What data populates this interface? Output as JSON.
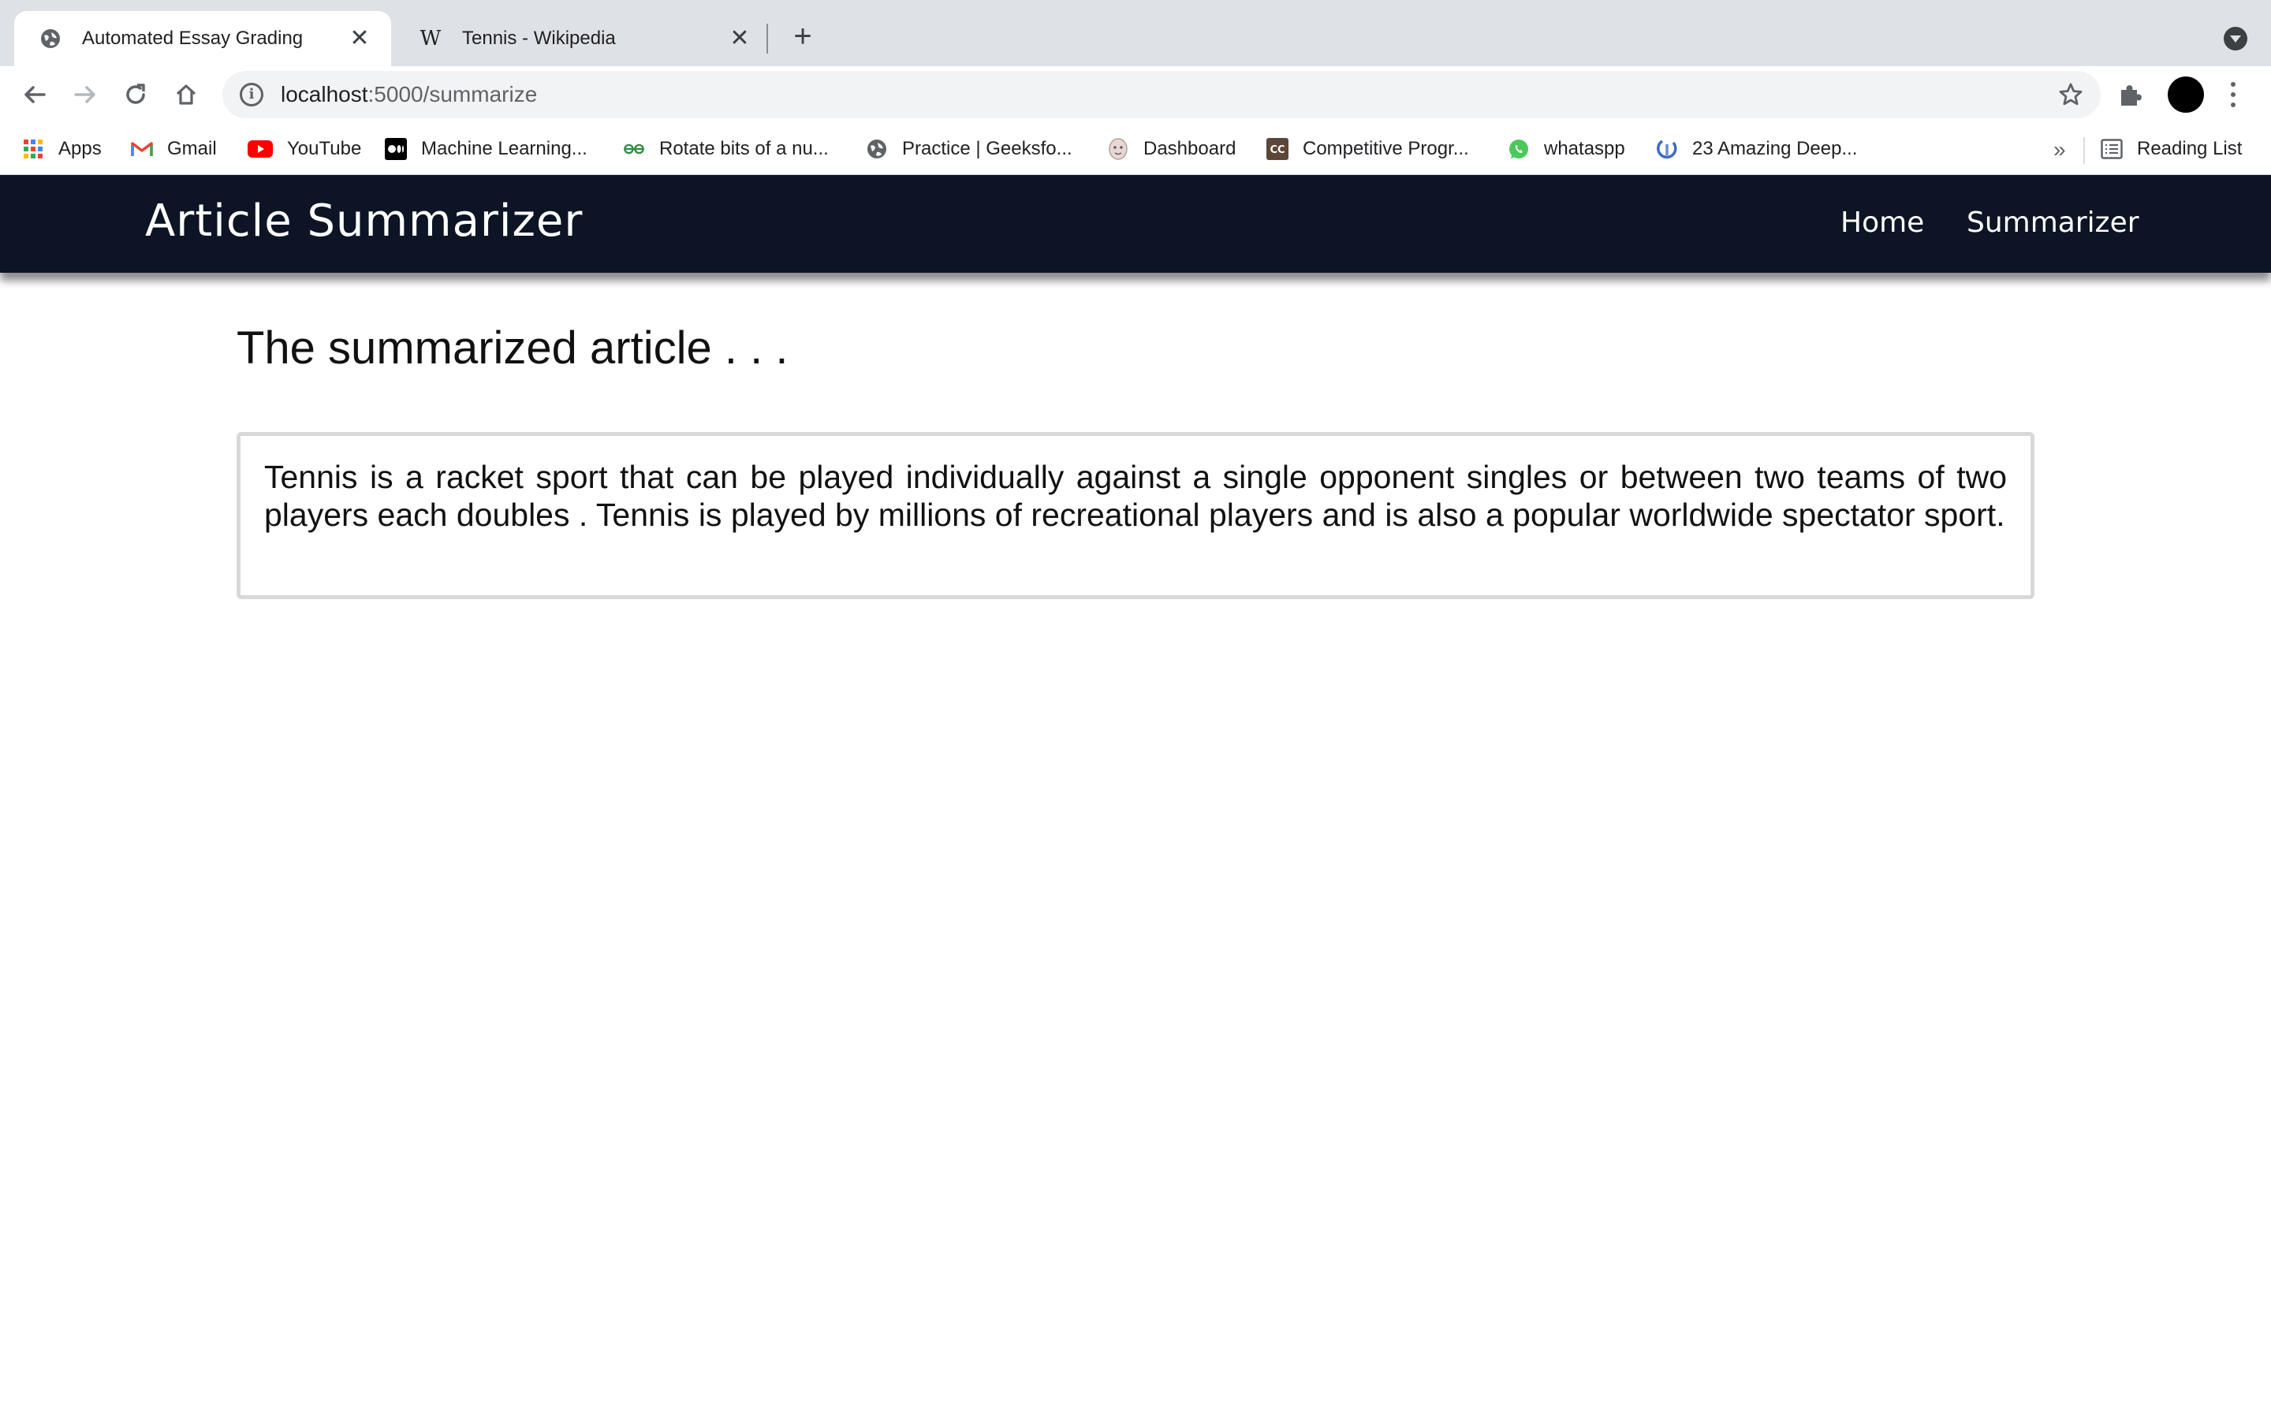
{
  "browser": {
    "tabs": [
      {
        "title": "Automated Essay Grading",
        "favicon": "globe-icon",
        "active": true
      },
      {
        "title": "Tennis - Wikipedia",
        "favicon": "wikipedia-icon",
        "active": false
      }
    ],
    "close_glyph": "✕",
    "new_tab_glyph": "+",
    "address": {
      "host": "localhost",
      "path": ":5000/summarize"
    },
    "bookmarks": [
      {
        "label": "Apps",
        "icon": "apps-grid-icon"
      },
      {
        "label": "Gmail",
        "icon": "gmail-icon"
      },
      {
        "label": "YouTube",
        "icon": "youtube-icon"
      },
      {
        "label": "Machine Learning...",
        "icon": "medium-icon"
      },
      {
        "label": "Rotate bits of a nu...",
        "icon": "geeksforgeeks-icon"
      },
      {
        "label": "Practice | Geeksfo...",
        "icon": "globe-icon"
      },
      {
        "label": "Dashboard",
        "icon": "dashboard-avatar-icon"
      },
      {
        "label": "Competitive Progr...",
        "icon": "codechef-icon"
      },
      {
        "label": "whataspp",
        "icon": "whatsapp-icon"
      },
      {
        "label": "23 Amazing Deep...",
        "icon": "deep-learning-icon"
      }
    ],
    "bookmarks_overflow": "»",
    "reading_list": "Reading List"
  },
  "site": {
    "brand": "Article Summarizer",
    "nav": {
      "home": "Home",
      "summarizer": "Summarizer"
    }
  },
  "main": {
    "heading": "The summarized article . . .",
    "summary": "Tennis is a racket sport that can be played individually against a single opponent singles or between two teams of two players each doubles . Tennis is played by millions of recreational players and is also a popular worldwide spectator sport."
  },
  "colors": {
    "navbar_bg": "#0c1426",
    "tabstrip_bg": "#dee1e6",
    "box_border": "#d8d8d8"
  }
}
